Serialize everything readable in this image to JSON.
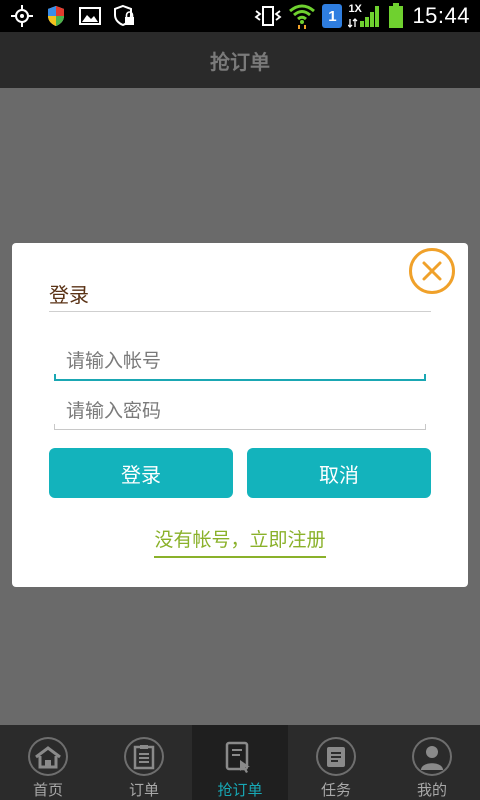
{
  "status_bar": {
    "time": "15:44",
    "sim_badge": "1",
    "network_type": "1X",
    "icons": [
      "gps-icon",
      "shield-icon",
      "image-icon",
      "security-icon",
      "vibrate-icon",
      "wifi-icon",
      "sim-icon",
      "signal-icon",
      "battery-icon"
    ]
  },
  "header": {
    "title": "抢订单"
  },
  "dialog": {
    "title": "登录",
    "username": {
      "placeholder": "请输入帐号",
      "value": ""
    },
    "password": {
      "placeholder": "请输入密码",
      "value": ""
    },
    "login_label": "登录",
    "cancel_label": "取消",
    "register_link": "没有帐号，立即注册"
  },
  "bottom_nav": {
    "items": [
      {
        "label": "首页",
        "icon": "home-icon"
      },
      {
        "label": "订单",
        "icon": "order-list-icon"
      },
      {
        "label": "抢订单",
        "icon": "grab-order-icon",
        "active": true
      },
      {
        "label": "任务",
        "icon": "task-icon"
      },
      {
        "label": "我的",
        "icon": "profile-icon"
      }
    ]
  },
  "colors": {
    "accent": "#13b3bc",
    "link": "#8ab12a",
    "close": "#f0a12a",
    "active_tab": "#17a7b4"
  }
}
